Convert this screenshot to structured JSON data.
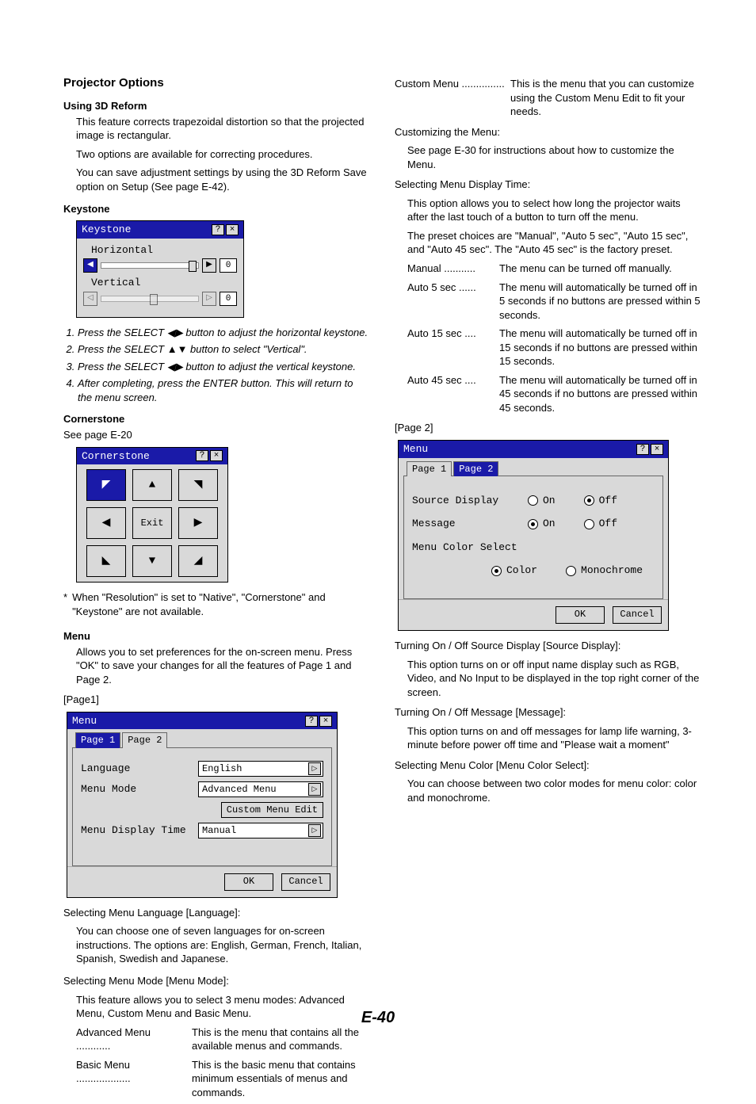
{
  "page_number": "E-40",
  "left": {
    "section_title": "Projector Options",
    "using3d": {
      "heading": "Using 3D Reform",
      "p1": "This feature corrects trapezoidal distortion so that the projected image is rectangular.",
      "p2": "Two options are available for correcting procedures.",
      "p3": "You can save adjustment settings by using the 3D Reform Save option on Setup (See page E-42)."
    },
    "keystone": {
      "heading": "Keystone",
      "win_title": "Keystone",
      "horiz_label": "Horizontal",
      "vert_label": "Vertical",
      "horiz_value": "0",
      "vert_value": "0",
      "steps": [
        "Press the SELECT ◀▶ button to adjust the horizontal keystone.",
        "Press the SELECT ▲▼ button to select \"Vertical\".",
        "Press the SELECT ◀▶ button to adjust the vertical keystone.",
        "After completing, press the ENTER button. This will return to the menu screen."
      ]
    },
    "cornerstone": {
      "heading": "Cornerstone",
      "seepage": "See page E-20",
      "win_title": "Cornerstone",
      "exit": "Exit",
      "footnote_star": "*",
      "footnote": "When \"Resolution\" is set to \"Native\", \"Cornerstone\" and \"Keystone\" are not available."
    },
    "menu": {
      "heading": "Menu",
      "desc": "Allows you to set preferences for the on-screen menu. Press \"OK\" to save your changes for all the features of Page 1 and Page 2.",
      "page1_label": "[Page1]",
      "win_title": "Menu",
      "tab1": "Page 1",
      "tab2": "Page 2",
      "language_label": "Language",
      "language_value": "English",
      "mode_label": "Menu Mode",
      "mode_value": "Advanced Menu",
      "custom_edit": "Custom Menu Edit",
      "display_time_label": "Menu Display Time",
      "display_time_value": "Manual",
      "ok": "OK",
      "cancel": "Cancel"
    },
    "lang": {
      "heading": "Selecting Menu Language [Language]:",
      "desc": "You can choose one of seven languages for on-screen instructions. The options are: English, German, French, Italian, Spanish, Swedish and Japanese."
    },
    "mode": {
      "heading": "Selecting Menu Mode [Menu Mode]:",
      "desc": "This feature allows you to select 3 menu modes: Advanced Menu, Custom Menu and Basic Menu.",
      "advanced_term": "Advanced Menu ............",
      "advanced_desc": "This is the menu that contains all the available menus and commands.",
      "basic_term": "Basic Menu ...................",
      "basic_desc": "This is the basic menu that contains minimum essentials of menus and commands."
    }
  },
  "right": {
    "custom_term": "Custom Menu ...............",
    "custom_desc": "This is the menu that you can customize using the Custom Menu Edit to fit your needs.",
    "customizing": {
      "heading": "Customizing the Menu:",
      "desc": "See page E-30 for instructions about how to customize the Menu."
    },
    "displaytime": {
      "heading": "Selecting Menu Display Time:",
      "p1": "This option allows you to select how long the projector waits after the last touch of a button to turn off the menu.",
      "p2": "The preset choices are \"Manual\", \"Auto 5 sec\", \"Auto 15 sec\", and \"Auto 45 sec\". The \"Auto 45 sec\" is the factory preset.",
      "rows": [
        {
          "term": "Manual ...........",
          "desc": "The menu can be turned off manually."
        },
        {
          "term": "Auto 5 sec ......",
          "desc": "The menu will automatically be turned off in 5 seconds if no buttons are pressed within 5 seconds."
        },
        {
          "term": "Auto 15 sec ....",
          "desc": "The menu will automatically be turned off in 15 seconds if no buttons are pressed within 15 seconds."
        },
        {
          "term": "Auto 45 sec ....",
          "desc": "The menu will automatically be turned off in 45 seconds if no buttons are pressed within 45 seconds."
        }
      ]
    },
    "page2_label": "[Page 2]",
    "menu2": {
      "win_title": "Menu",
      "tab1": "Page 1",
      "tab2": "Page 2",
      "source_label": "Source Display",
      "on": "On",
      "off": "Off",
      "message_label": "Message",
      "color_label": "Menu Color Select",
      "color": "Color",
      "mono": "Monochrome",
      "ok": "OK",
      "cancel": "Cancel"
    },
    "src": {
      "heading": "Turning On / Off Source Display [Source Display]:",
      "desc": "This option turns on or off input name display such as RGB, Video, and No Input to be displayed in the top right corner of the screen."
    },
    "msg": {
      "heading": "Turning On / Off Message [Message]:",
      "desc": "This option turns on and off messages for lamp life warning, 3-minute before power off time and \"Please wait a moment\""
    },
    "col": {
      "heading": "Selecting Menu Color [Menu Color Select]:",
      "desc": "You can choose between two color modes for menu color: color and monochrome."
    }
  }
}
